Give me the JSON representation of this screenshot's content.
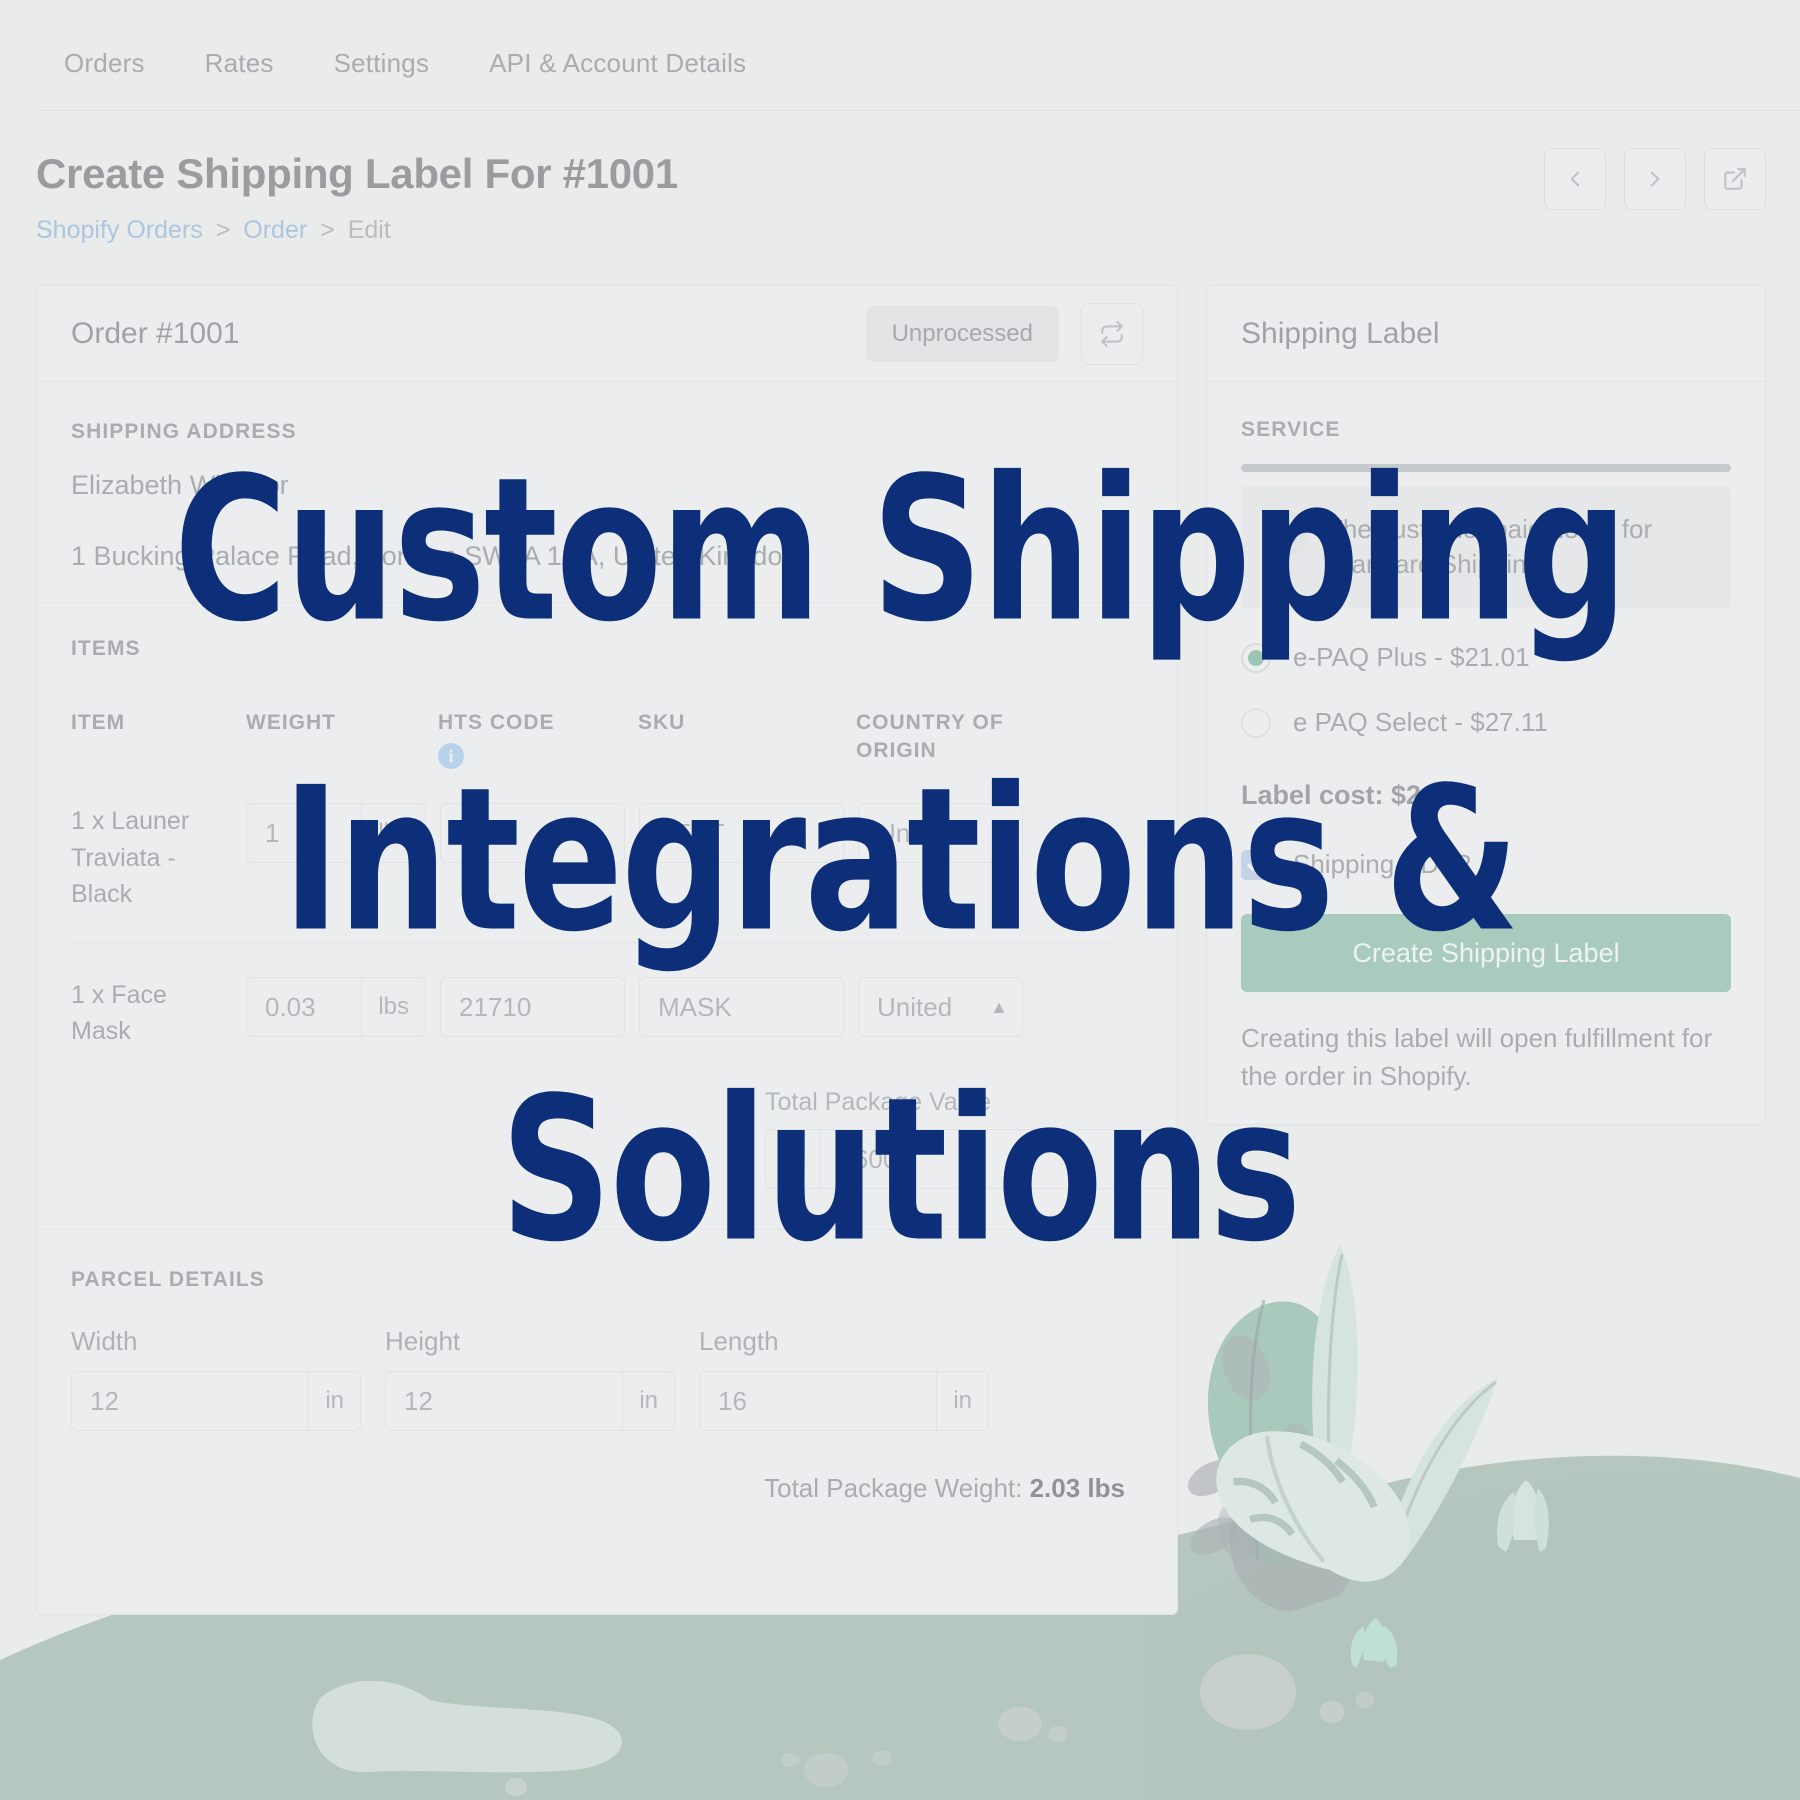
{
  "colors": {
    "page_bg": "#eaebeb",
    "card_bg": "#ecedee",
    "muted_text": "#a9adb0",
    "link_blue": "#adc6e0",
    "accent_green": "#a8cbbd",
    "radio_green": "#9cc6b4",
    "checkbox_blue": "#c4d3e6",
    "headline_navy": "#0d2f7a",
    "illustration_ground": "#b6c7c0"
  },
  "topnav": {
    "items": [
      {
        "label": "Orders"
      },
      {
        "label": "Rates"
      },
      {
        "label": "Settings"
      },
      {
        "label": "API & Account Details"
      }
    ]
  },
  "header": {
    "title": "Create Shipping Label For #1001",
    "breadcrumb": {
      "root": "Shopify Orders",
      "sep1": ">",
      "parent": "Order",
      "sep2": ">",
      "current": "Edit"
    },
    "actions": [
      {
        "name": "previous-order-button",
        "icon": "chevron-left-icon"
      },
      {
        "name": "next-order-button",
        "icon": "chevron-right-icon"
      },
      {
        "name": "open-external-button",
        "icon": "external-link-icon"
      }
    ]
  },
  "order_card": {
    "title": "Order #1001",
    "status": "Unprocessed",
    "swap_icon": "swap-arrows-icon",
    "shipping_address": {
      "label": "SHIPPING ADDRESS",
      "name": "Elizabeth Windsor",
      "address": "1 Bucking Palace Road, London SW1A 1AA, United Kingdom"
    },
    "items": {
      "label": "ITEMS",
      "columns": {
        "item": "ITEM",
        "weight": "WEIGHT",
        "hts_code": "HTS CODE",
        "hts_info_icon": "info-icon",
        "sku": "SKU",
        "country_of_origin_line1": "COUNTRY OF",
        "country_of_origin_line2": "ORIGIN"
      },
      "rows": [
        {
          "name": "1 x Launer Traviata - Black",
          "weight": "1",
          "weight_unit": "lbs",
          "hts_code": "4202",
          "sku": "TEST",
          "country": "United"
        },
        {
          "name": "1 x Face Mask",
          "weight": "0.03",
          "weight_unit": "lbs",
          "hts_code": "21710",
          "sku": "MASK",
          "country": "United"
        }
      ],
      "total_package_value_label": "Total Package Value",
      "total_package_value_prefix": "$",
      "total_package_value": "3600"
    },
    "parcel": {
      "label": "PARCEL DETAILS",
      "fields": [
        {
          "label": "Width",
          "value": "12",
          "unit": "in"
        },
        {
          "label": "Height",
          "value": "12",
          "unit": "in"
        },
        {
          "label": "Length",
          "value": "16",
          "unit": "in"
        }
      ],
      "total_weight_label": "Total Package Weight:",
      "total_weight_value": "2.03 lbs"
    }
  },
  "label_card": {
    "title": "Shipping Label",
    "service_label": "SERVICE",
    "notice": {
      "icon": "sparkle-icon",
      "text": "The customer paid 28.00 for Standard Shipping"
    },
    "services": [
      {
        "label": "e-PAQ Plus - $21.01",
        "selected": true
      },
      {
        "label": "e PAQ Select - $27.11",
        "selected": false
      }
    ],
    "label_cost": "Label cost: $21.01",
    "ddp": {
      "label": "Shipping DDP?",
      "checked": true,
      "icon": "checkmark-icon"
    },
    "create_button": "Create Shipping Label",
    "helper_text": "Creating this label will open fulfillment for the order in Shopify."
  },
  "overlay": {
    "line1": "Custom Shipping",
    "line2": "Integrations &",
    "line3": "Solutions"
  }
}
